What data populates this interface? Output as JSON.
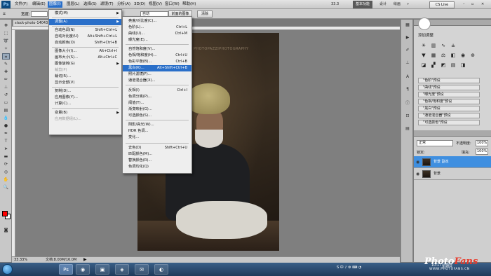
{
  "menubar": {
    "logo": "Ps",
    "items": [
      "文件(F)",
      "编辑(E)",
      "图像(I)",
      "图层(L)",
      "选择(S)",
      "滤镜(T)",
      "分析(A)",
      "3D(D)",
      "视图(V)",
      "窗口(W)",
      "帮助(H)"
    ],
    "zoom": "33.3",
    "workspace": "基本功能",
    "design": "设计",
    "painting": "绘画",
    "cs_live": "CS Live"
  },
  "options": {
    "width_label": "宽度:",
    "auto_label": "自动",
    "front_image_button": "前面的图像",
    "clear_button": "清除"
  },
  "document": {
    "tab_title": "stock-photo-14043",
    "watermark": "PHOTOPAZZIPHOTOGRAPHY",
    "zoom_status": "33.33%",
    "doc_size": "文档:8.00M/16.0M"
  },
  "image_menu": {
    "items": [
      {
        "label": "模式(M)",
        "shortcut": "",
        "submenu": true
      },
      {
        "label": "调整(A)",
        "shortcut": "",
        "submenu": true,
        "highlight": true
      },
      {
        "label": "自动色调(N)",
        "shortcut": "Shift+Ctrl+L"
      },
      {
        "label": "自动对比度(U)",
        "shortcut": "Alt+Shift+Ctrl+L"
      },
      {
        "label": "自动颜色(O)",
        "shortcut": "Shift+Ctrl+B"
      },
      {
        "label": "图像大小(I)...",
        "shortcut": "Alt+Ctrl+I"
      },
      {
        "label": "画布大小(S)...",
        "shortcut": "Alt+Ctrl+C"
      },
      {
        "label": "图像旋转(G)",
        "shortcut": "",
        "submenu": true
      },
      {
        "label": "裁剪(P)",
        "shortcut": "",
        "disabled": true
      },
      {
        "label": "裁切(R)...",
        "shortcut": ""
      },
      {
        "label": "显示全部(V)",
        "shortcut": ""
      },
      {
        "label": "复制(D)...",
        "shortcut": ""
      },
      {
        "label": "应用图像(Y)...",
        "shortcut": ""
      },
      {
        "label": "计算(C)...",
        "shortcut": ""
      },
      {
        "label": "变量(B)",
        "shortcut": "",
        "submenu": true
      },
      {
        "label": "应用数据组(L)...",
        "shortcut": "",
        "disabled": true
      }
    ]
  },
  "adjust_menu": {
    "items": [
      {
        "label": "亮度/对比度(C)...",
        "shortcut": ""
      },
      {
        "label": "色阶(L)...",
        "shortcut": "Ctrl+L"
      },
      {
        "label": "曲线(U)...",
        "shortcut": "Ctrl+M"
      },
      {
        "label": "曝光度(E)...",
        "shortcut": ""
      },
      {
        "label": "自然饱和度(V)...",
        "shortcut": ""
      },
      {
        "label": "色相/饱和度(H)...",
        "shortcut": "Ctrl+U"
      },
      {
        "label": "色彩平衡(B)...",
        "shortcut": "Ctrl+B"
      },
      {
        "label": "黑白(K)...",
        "shortcut": "Alt+Shift+Ctrl+B",
        "highlight": true
      },
      {
        "label": "照片滤镜(F)...",
        "shortcut": ""
      },
      {
        "label": "通道混合器(X)...",
        "shortcut": ""
      },
      {
        "label": "反相(I)",
        "shortcut": "Ctrl+I"
      },
      {
        "label": "色调分离(P)...",
        "shortcut": ""
      },
      {
        "label": "阈值(T)...",
        "shortcut": ""
      },
      {
        "label": "渐变映射(G)...",
        "shortcut": ""
      },
      {
        "label": "可选颜色(S)...",
        "shortcut": ""
      },
      {
        "label": "阴影/高光(W)...",
        "shortcut": ""
      },
      {
        "label": "HDR 色调...",
        "shortcut": ""
      },
      {
        "label": "变化...",
        "shortcut": ""
      },
      {
        "label": "去色(D)",
        "shortcut": "Shift+Ctrl+U"
      },
      {
        "label": "匹配颜色(M)...",
        "shortcut": ""
      },
      {
        "label": "替换颜色(R)...",
        "shortcut": ""
      },
      {
        "label": "色调均化(Q)",
        "shortcut": ""
      }
    ]
  },
  "panels": {
    "adjust_tab": "调整",
    "add_adjustment": "添加调整",
    "presets": [
      "\"色阶\"预设",
      "\"曲线\"预设",
      "\"曝光度\"预设",
      "\"色相/饱和度\"预设",
      "\"黑白\"预设",
      "\"通道混合器\"预设",
      "\"可选颜色\"预设"
    ],
    "layers_tabs": [
      "图层",
      "通道",
      "路径"
    ],
    "blend_mode": "正常",
    "opacity_label": "不透明度:",
    "opacity_value": "100%",
    "lock_label": "锁定:",
    "fill_label": "填充:",
    "fill_value": "100%",
    "layers": [
      {
        "name": "背景 副本",
        "selected": true
      },
      {
        "name": "背景",
        "selected": false
      }
    ]
  },
  "taskbar": {
    "time": "10:17",
    "date": "星期日"
  },
  "brand": {
    "logo_main": "Photo",
    "logo_accent": "Fans",
    "url": "WWW.PHOTOFANS.CN"
  }
}
